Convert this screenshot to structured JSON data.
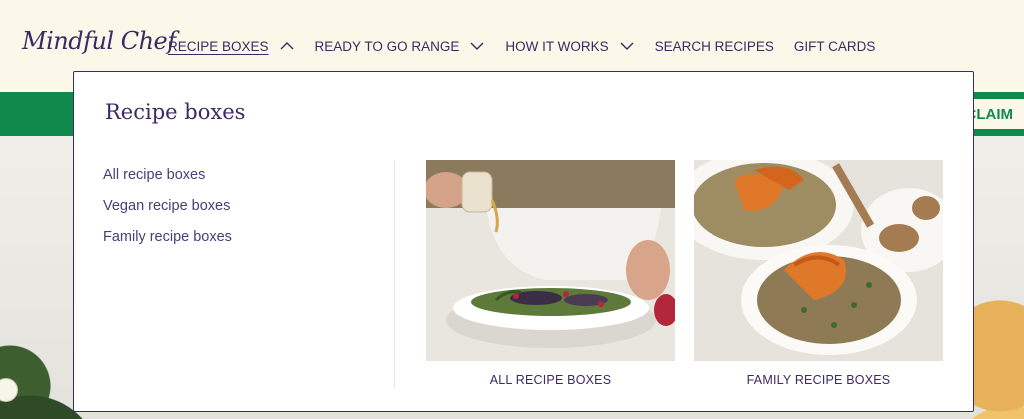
{
  "brand": {
    "logo_text": "Mindful Chef"
  },
  "nav": {
    "items": [
      {
        "label": "RECIPE BOXES",
        "has_chevron": true,
        "expanded": true
      },
      {
        "label": "READY TO GO RANGE",
        "has_chevron": true,
        "expanded": false
      },
      {
        "label": "HOW IT WORKS",
        "has_chevron": true,
        "expanded": false
      },
      {
        "label": "SEARCH RECIPES",
        "has_chevron": false
      },
      {
        "label": "GIFT CARDS",
        "has_chevron": false
      }
    ]
  },
  "promo": {
    "claim_label": "CLAIM"
  },
  "dropdown": {
    "title": "Recipe boxes",
    "links": [
      {
        "label": "All recipe boxes"
      },
      {
        "label": "Vegan recipe boxes"
      },
      {
        "label": "Family recipe boxes"
      }
    ],
    "cards": [
      {
        "caption": "ALL RECIPE BOXES",
        "image": "salad-bowl-photo"
      },
      {
        "caption": "FAMILY RECIPE BOXES",
        "image": "roasted-squash-plates-photo"
      }
    ]
  },
  "colors": {
    "brand_purple": "#3b2a63",
    "promo_green": "#0f8a4c",
    "header_cream": "#fbf8ea"
  }
}
